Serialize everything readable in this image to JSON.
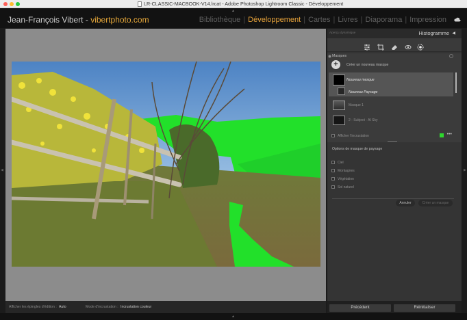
{
  "window": {
    "title": "LR-CLASSIC-MACBOOK-V14.lrcat - Adobe Photoshop Lightroom Classic - Développement"
  },
  "identity_plate": {
    "name": "Jean-François Vibert",
    "separator": "-",
    "website": "vibertphoto.com",
    "name_color": "#d0d0d0",
    "website_color": "#e8a93a"
  },
  "modules": {
    "items": [
      {
        "label": "Bibliothèque",
        "active": false
      },
      {
        "label": "Développement",
        "active": true
      },
      {
        "label": "Cartes",
        "active": false
      },
      {
        "label": "Livres",
        "active": false
      },
      {
        "label": "Diaporama",
        "active": false
      },
      {
        "label": "Impression",
        "active": false
      }
    ],
    "separator": "|",
    "active_color": "#e6a23a"
  },
  "right_panel": {
    "navigator_label": "Aperçu dynamique",
    "histogram_title": "Histogramme",
    "tools": [
      "sliders-icon",
      "crop-icon",
      "eraser-icon",
      "redeye-icon",
      "mask-icon"
    ],
    "masks": {
      "title": "Masques",
      "create_label": "Créer un nouveau masque",
      "selected_mask": "Nouveau masque",
      "selected_sub": "Nouveau Paysage",
      "items": [
        {
          "label": "Masque 1"
        },
        {
          "label": "2 - Subject - AI Sky"
        }
      ],
      "overlay_label": "Afficher l'incrustation",
      "overlay_color": "#2ed82e"
    },
    "landscape_options": {
      "title": "Options de masque de paysage",
      "items": [
        "Ciel",
        "Montagnes",
        "Végétation",
        "Sol naturel"
      ],
      "cancel_label": "Annuler",
      "create_label": "Créer un masque"
    },
    "bottom_buttons": {
      "previous": "Précédent",
      "reset": "Réinitialiser"
    }
  },
  "toolbar": {
    "pins_label": "Afficher les épingles d'édition :",
    "pins_value": "Auto",
    "overlay_mode_label": "Mode d'incrustation :",
    "overlay_mode_value": "Incrustation couleur"
  }
}
